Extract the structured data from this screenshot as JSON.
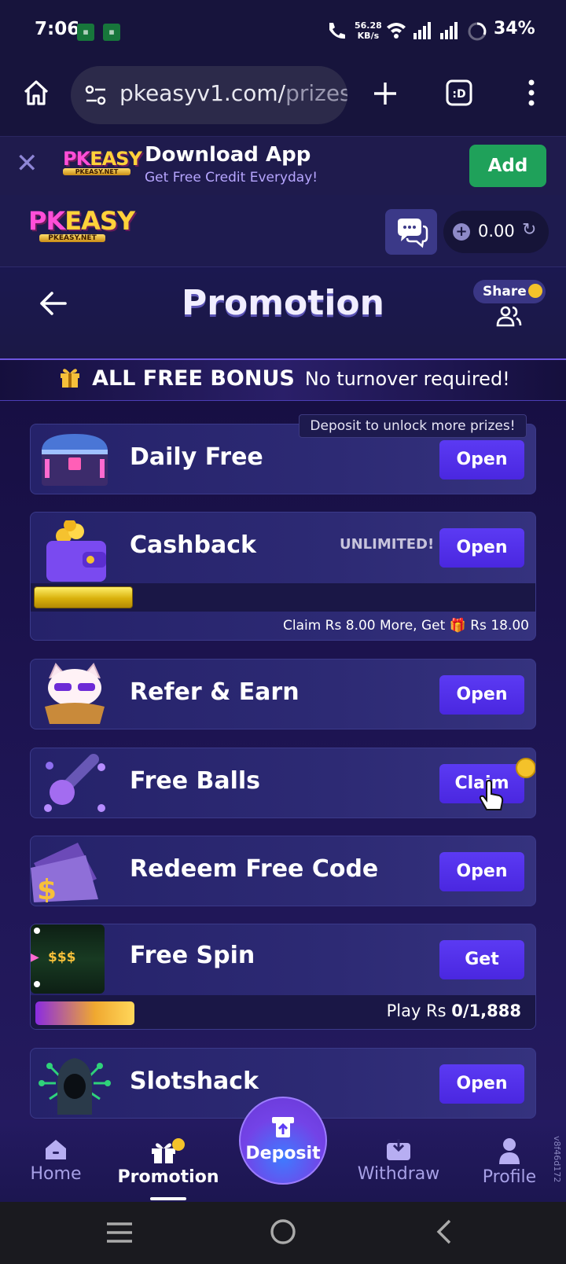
{
  "status_bar": {
    "time": "7:06",
    "net_speed_value": "56.28",
    "net_speed_unit": "KB/s",
    "battery": "34%"
  },
  "browser": {
    "url_visible": "pkeasyv1.com/",
    "url_faded": "prizes"
  },
  "download_banner": {
    "title": "Download App",
    "subtitle": "Get Free Credit Everyday!",
    "add_label": "Add"
  },
  "header": {
    "balance": "0.00"
  },
  "promo": {
    "title": "Promotion",
    "share_label": "Share",
    "bonus_title": "ALL FREE BONUS",
    "bonus_subtitle": "No turnover required!",
    "tooltip": "Deposit to unlock more prizes!",
    "cards": [
      {
        "name": "Daily Free",
        "button": "Open"
      },
      {
        "name": "Cashback",
        "button": "Open",
        "badge": "UNLIMITED!",
        "progress_text_prefix": "Claim Rs 8.00 More, Get",
        "progress_text_suffix": "Rs 18.00",
        "progress": 0.2
      },
      {
        "name": "Refer & Earn",
        "button": "Open"
      },
      {
        "name": "Free Balls",
        "button": "Claim"
      },
      {
        "name": "Redeem Free Code",
        "button": "Open"
      },
      {
        "name": "Free Spin",
        "button": "Get",
        "thumb_text": "$$$",
        "play_label": "Play Rs",
        "play_value": "0/1,888",
        "progress": 0.2
      },
      {
        "name": "Slotshack",
        "button": "Open"
      }
    ]
  },
  "bottom_nav": {
    "home": "Home",
    "promotion": "Promotion",
    "deposit": "Deposit",
    "withdraw": "Withdraw",
    "profile": "Profile",
    "version": "v8f46d172"
  },
  "colors": {
    "accent_button": "#4a27e0",
    "add_green": "#1fa15a",
    "background": "#13103a"
  }
}
